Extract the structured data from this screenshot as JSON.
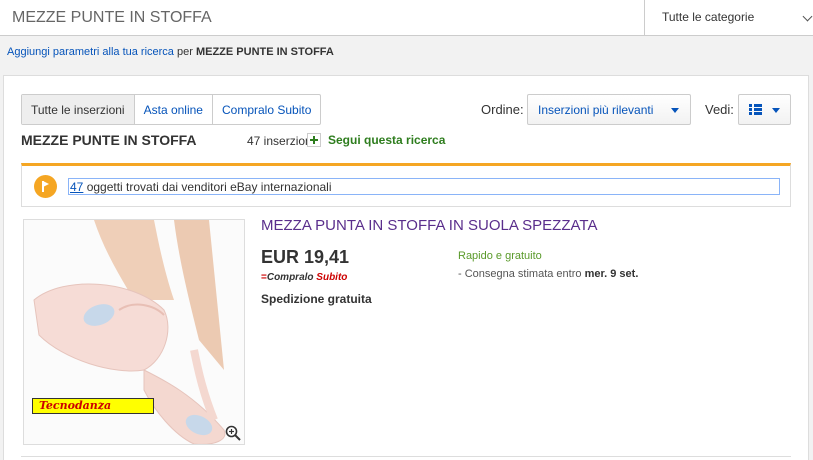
{
  "search": {
    "value": "MEZZE PUNTE IN STOFFA",
    "category": "Tutte le categorie"
  },
  "refine": {
    "link": "Aggiungi parametri alla tua ricerca",
    "for": "per",
    "query": "MEZZE PUNTE IN STOFFA"
  },
  "tabs": [
    {
      "label": "Tutte le inserzioni"
    },
    {
      "label": "Asta online"
    },
    {
      "label": "Compralo Subito"
    }
  ],
  "sort": {
    "label": "Ordine:",
    "value": "Inserzioni più rilevanti"
  },
  "view": {
    "label": "Vedi:",
    "icon": "list-view-icon"
  },
  "results": {
    "title": "MEZZE PUNTE IN STOFFA",
    "count": "47 inserzioni",
    "follow": "Segui questa ricerca"
  },
  "notice": {
    "count": "47",
    "text": " oggetti trovati dai venditori eBay internazionali"
  },
  "listing": {
    "title": "MEZZA PUNTA IN STOFFA IN SUOLA SPEZZATA",
    "price": "EUR 19,41",
    "buy_now_prefix": "Compralo",
    "buy_now_suffix": "Subito",
    "shipping": "Spedizione gratuita",
    "fast": "Rapido e gratuito",
    "delivery_prefix": "- Consegna stimata entro",
    "delivery_date": "mer. 9 set.",
    "image_brand": "Tecnodanza"
  },
  "colors": {
    "link": "#0654ba",
    "accent": "#f5a623",
    "follow": "#2e7d1e",
    "title": "#5a2e8c"
  }
}
